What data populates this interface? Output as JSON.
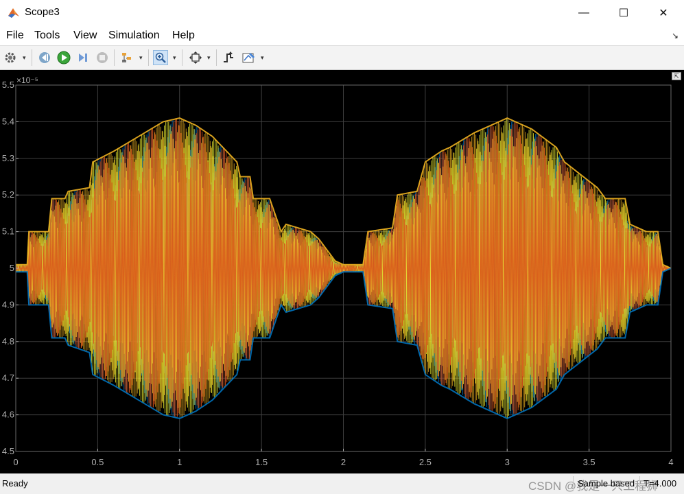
{
  "window": {
    "title": "Scope3",
    "minimize_glyph": "—",
    "maximize_glyph": "☐",
    "close_glyph": "✕"
  },
  "menu": {
    "items": [
      {
        "label": "File",
        "accel": "F"
      },
      {
        "label": "Tools",
        "accel": "T"
      },
      {
        "label": "View",
        "accel": "V"
      },
      {
        "label": "Simulation",
        "accel": "i"
      },
      {
        "label": "Help",
        "accel": "H"
      }
    ],
    "dock_glyph": "↘"
  },
  "toolbar": {
    "icons": [
      "gear-icon",
      "step-back-icon",
      "run-icon",
      "step-forward-icon",
      "stop-icon",
      "highlight-icon",
      "zoom-in-icon",
      "fit-axes-icon",
      "triggers-icon",
      "cursor-measure-icon"
    ],
    "drop_glyph": "▾",
    "zoom_active": true
  },
  "plot": {
    "exponent_label": "×10⁻⁵",
    "colors": {
      "background": "#000000",
      "grid": "#3f3f3f",
      "tick_label": "#b0b0b0",
      "series": [
        "#0072bd",
        "#edb120",
        "#ffff33",
        "#d95319"
      ]
    }
  },
  "chart_data": {
    "type": "line",
    "title": "",
    "xlabel": "",
    "ylabel": "",
    "xlim": [
      0,
      4
    ],
    "ylim": [
      4.5,
      5.5
    ],
    "y_scale_factor": "1e-5",
    "xticks": [
      "0",
      "0.5",
      "1",
      "1.5",
      "2",
      "2.5",
      "3",
      "3.5",
      "4"
    ],
    "yticks": [
      "4.5",
      "4.6",
      "4.7",
      "4.8",
      "4.9",
      "5",
      "5.1",
      "5.2",
      "5.3",
      "5.4",
      "5.5"
    ],
    "grid": true,
    "series_colors": [
      "#0072bd",
      "#edb120",
      "#ffff33",
      "#d95319"
    ],
    "envelope": {
      "x": [
        0,
        0.07,
        0.08,
        0.2,
        0.22,
        0.3,
        0.32,
        0.45,
        0.47,
        0.6,
        0.75,
        0.9,
        1.0,
        1.1,
        1.2,
        1.35,
        1.37,
        1.43,
        1.45,
        1.55,
        1.62,
        1.65,
        1.8,
        1.85,
        1.95,
        2.0,
        2.05,
        2.12,
        2.15,
        2.3,
        2.33,
        2.45,
        2.5,
        2.6,
        2.65,
        2.8,
        3.0,
        3.15,
        3.3,
        3.35,
        3.55,
        3.6,
        3.72,
        3.75,
        3.85,
        3.92,
        3.95,
        4.0
      ],
      "upper": [
        5.01,
        5.01,
        5.1,
        5.1,
        5.19,
        5.19,
        5.21,
        5.22,
        5.29,
        5.32,
        5.36,
        5.4,
        5.41,
        5.39,
        5.36,
        5.29,
        5.25,
        5.25,
        5.19,
        5.19,
        5.1,
        5.12,
        5.1,
        5.08,
        5.02,
        5.01,
        5.01,
        5.01,
        5.1,
        5.11,
        5.2,
        5.21,
        5.29,
        5.32,
        5.33,
        5.37,
        5.41,
        5.38,
        5.33,
        5.29,
        5.22,
        5.19,
        5.19,
        5.12,
        5.1,
        5.1,
        5.01,
        5.0
      ],
      "lower": [
        4.99,
        4.99,
        4.9,
        4.9,
        4.81,
        4.81,
        4.79,
        4.77,
        4.71,
        4.68,
        4.64,
        4.6,
        4.59,
        4.61,
        4.64,
        4.71,
        4.75,
        4.75,
        4.81,
        4.81,
        4.9,
        4.88,
        4.9,
        4.92,
        4.98,
        4.99,
        4.99,
        4.99,
        4.9,
        4.89,
        4.8,
        4.79,
        4.71,
        4.68,
        4.67,
        4.63,
        4.59,
        4.62,
        4.67,
        4.71,
        4.78,
        4.81,
        4.81,
        4.88,
        4.9,
        4.9,
        4.99,
        5.0
      ]
    }
  },
  "status": {
    "left": "Ready",
    "mode": "Sample based",
    "time": "T=4.000"
  },
  "watermark": "CSDN @我是一只工程狮"
}
